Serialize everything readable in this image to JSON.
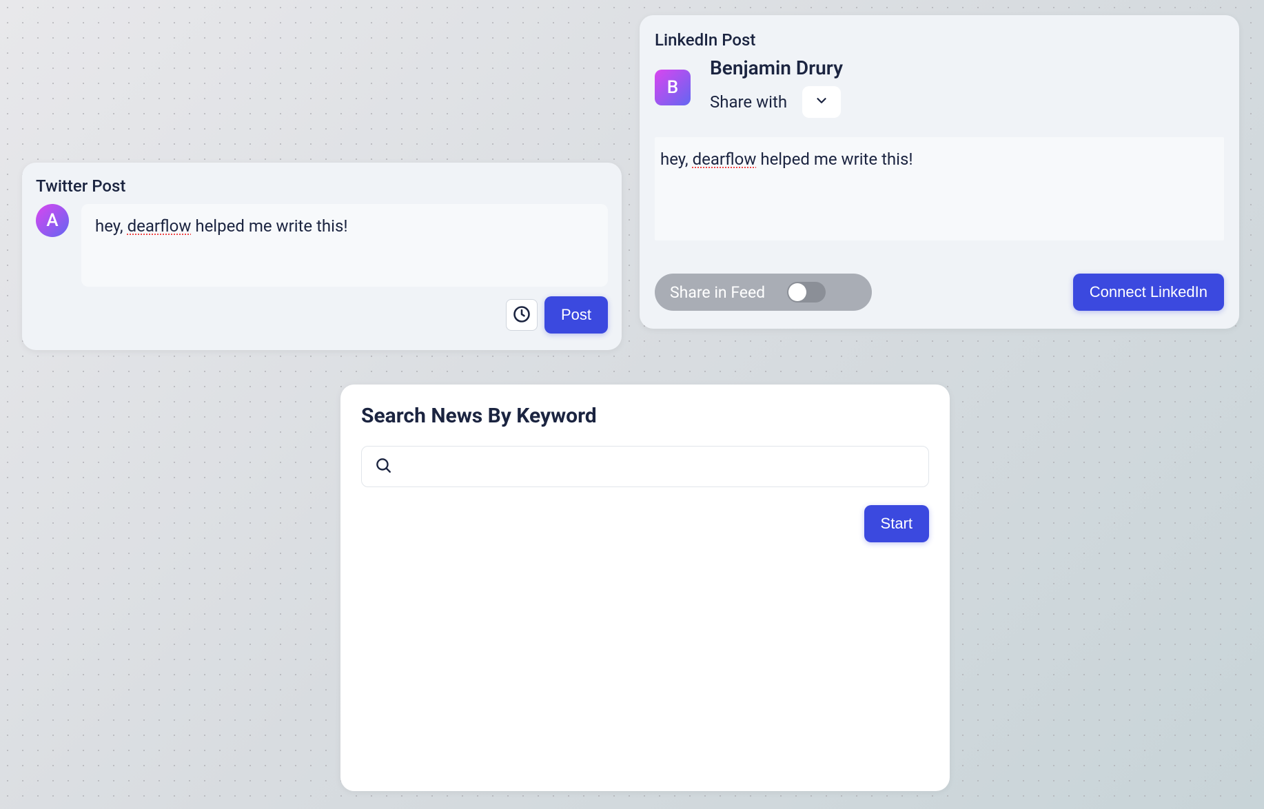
{
  "twitter": {
    "title": "Twitter Post",
    "avatar_initial": "A",
    "content_prefix": "hey, ",
    "content_spell": "dearflow",
    "content_suffix": " helped me write this!",
    "post_button": "Post"
  },
  "linkedin": {
    "title": "LinkedIn Post",
    "avatar_initial": "B",
    "user_name": "Benjamin Drury",
    "share_with_label": "Share with",
    "content_prefix": "hey, ",
    "content_spell": "dearflow",
    "content_suffix": " helped me write this!",
    "share_in_feed_label": "Share in Feed",
    "connect_button": "Connect LinkedIn"
  },
  "search": {
    "title": "Search News By Keyword",
    "placeholder": "",
    "start_button": "Start"
  }
}
